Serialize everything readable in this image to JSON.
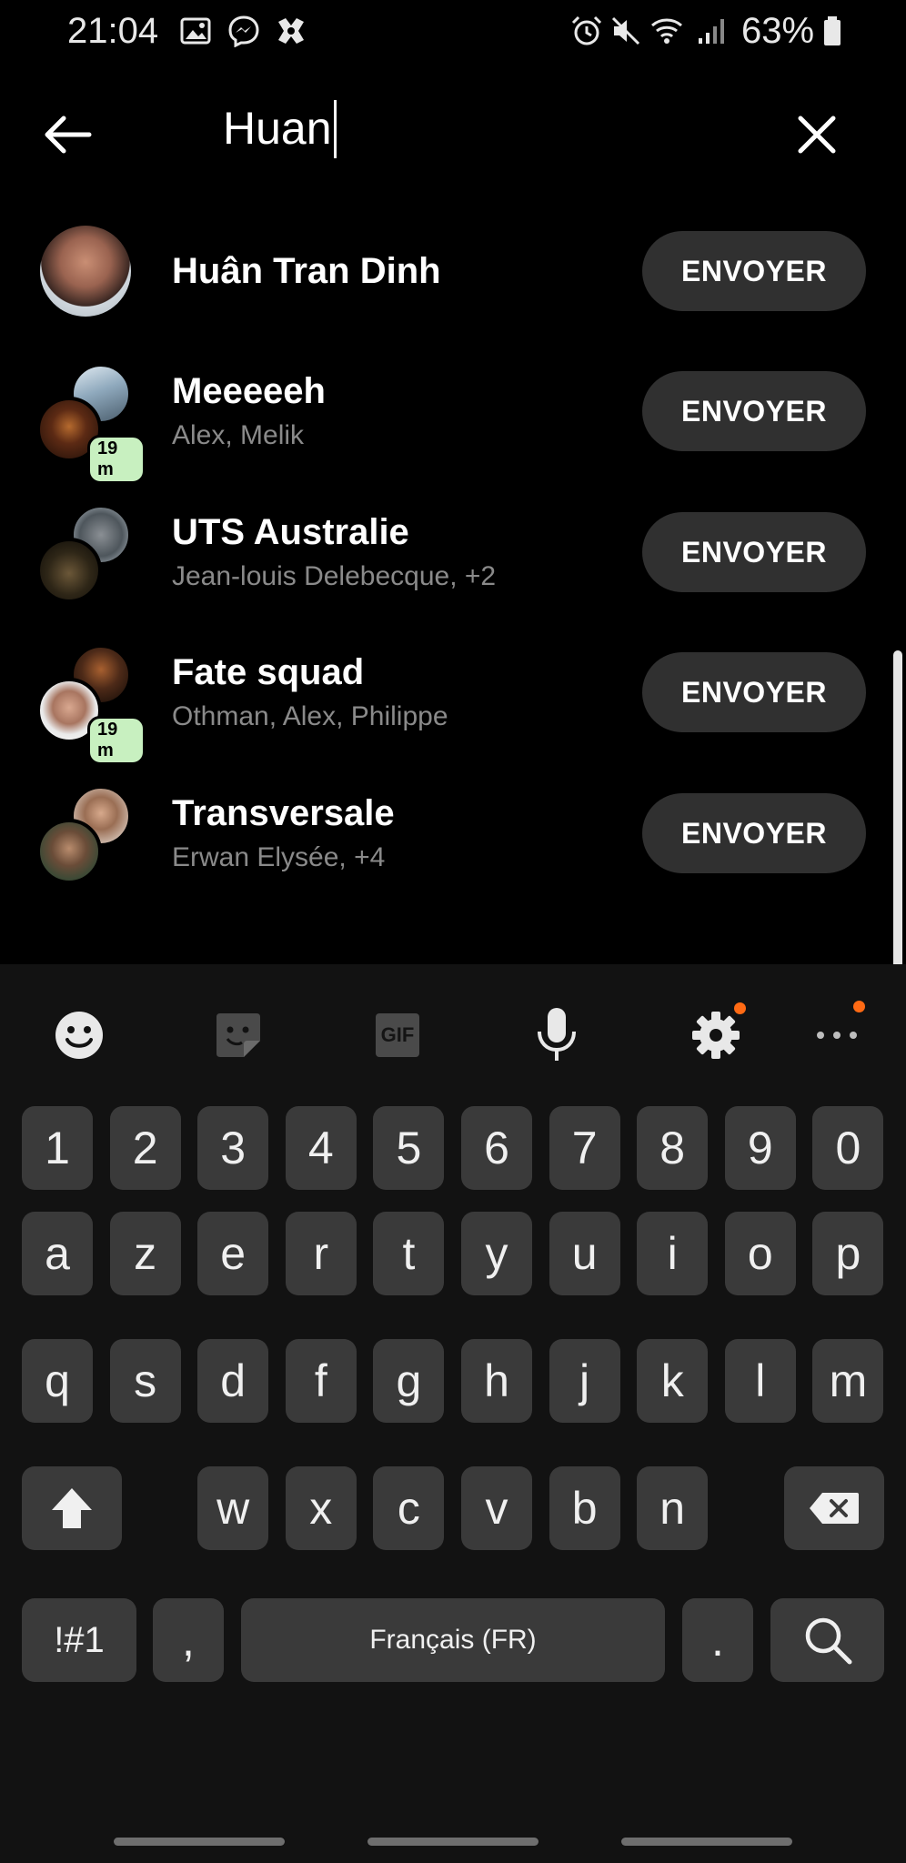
{
  "status": {
    "time": "21:04",
    "battery": "63%",
    "icons": [
      "image-icon",
      "messenger-icon",
      "app-icon",
      "alarm-icon",
      "mute-icon",
      "wifi-icon",
      "signal-icon",
      "battery-icon"
    ]
  },
  "search": {
    "query": "Huan"
  },
  "results": [
    {
      "name": "Huân Tran Dinh",
      "subtitle": "",
      "badge": "",
      "button": "ENVOYER"
    },
    {
      "name": "Meeeeeh",
      "subtitle": "Alex, Melik",
      "badge": "19 m",
      "button": "ENVOYER"
    },
    {
      "name": "UTS Australie",
      "subtitle": "Jean-louis Delebecque, +2",
      "badge": "",
      "button": "ENVOYER"
    },
    {
      "name": "Fate squad",
      "subtitle": "Othman, Alex, Philippe",
      "badge": "19 m",
      "button": "ENVOYER"
    },
    {
      "name": "Transversale",
      "subtitle": "Erwan Elysée, +4",
      "badge": "",
      "button": "ENVOYER"
    }
  ],
  "keyboard": {
    "toolbar": [
      "emoji-icon",
      "sticker-icon",
      "gif-icon",
      "microphone-icon",
      "settings-icon",
      "more-icon"
    ],
    "gif_label": "GIF",
    "row_numbers": [
      "1",
      "2",
      "3",
      "4",
      "5",
      "6",
      "7",
      "8",
      "9",
      "0"
    ],
    "row1": [
      "a",
      "z",
      "e",
      "r",
      "t",
      "y",
      "u",
      "i",
      "o",
      "p"
    ],
    "row2": [
      "q",
      "s",
      "d",
      "f",
      "g",
      "h",
      "j",
      "k",
      "l",
      "m"
    ],
    "row3": [
      "w",
      "x",
      "c",
      "v",
      "b",
      "n"
    ],
    "symbols_label": "!#1",
    "comma": ",",
    "space_label": "Français (FR)",
    "period": ".",
    "accent_color": "#ff6a14"
  }
}
